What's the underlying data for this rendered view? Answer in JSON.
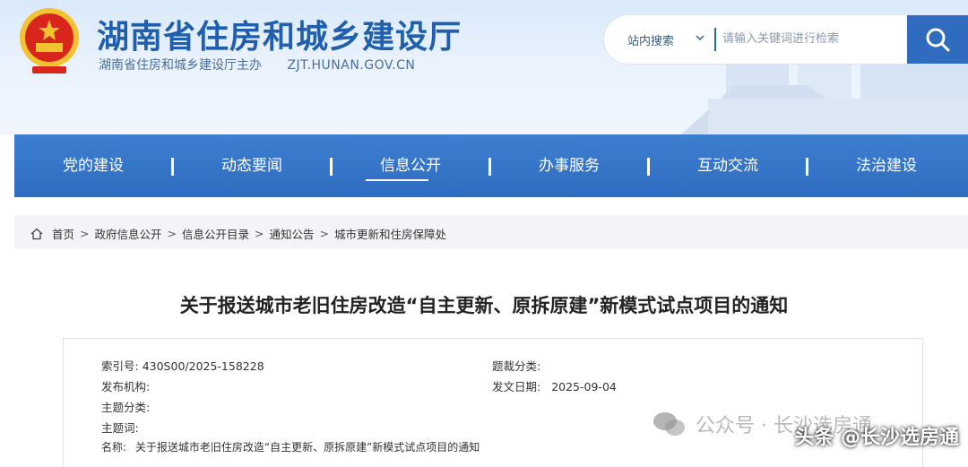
{
  "header": {
    "site_title": "湖南省住房和城乡建设厅",
    "site_subtitle": "湖南省住房和城乡建设厅主办",
    "site_url": "ZJT.HUNAN.GOV.CN",
    "search": {
      "scope": "站内搜索",
      "placeholder": "请输入关键词进行检索"
    }
  },
  "nav": {
    "items": [
      {
        "label": "党的建设"
      },
      {
        "label": "动态要闻"
      },
      {
        "label": "信息公开"
      },
      {
        "label": "办事服务"
      },
      {
        "label": "互动交流"
      },
      {
        "label": "法治建设"
      }
    ],
    "active": "信息公开"
  },
  "breadcrumb": [
    "首页",
    "政府信息公开",
    "信息公开目录",
    "通知公告",
    "城市更新和住房保障处"
  ],
  "article": {
    "title": "关于报送城市老旧住房改造“自主更新、原拆原建”新模式试点项目的通知",
    "meta": {
      "index_label": "索引号:",
      "index_value": "430S00/2025-158228",
      "theme_class_label": "题裁分类:",
      "issuer_label": "发布机构:",
      "date_label": "发文日期:",
      "date_value": "2025-09-04",
      "subject_class_label": "主题分类:",
      "keywords_label": "主题词:",
      "name_label": "名称:",
      "name_value": "关于报送城市老旧住房改造“自主更新、原拆原建”新模式试点项目的通知"
    }
  },
  "watermark": {
    "text": "公众号 · 长沙选房通",
    "overlay": "头条 @长沙选房通"
  },
  "colors": {
    "brand_blue": "#2d6cc0",
    "title_blue": "#1f5fae",
    "emblem_red": "#d8261d",
    "emblem_gold": "#f2c230"
  }
}
